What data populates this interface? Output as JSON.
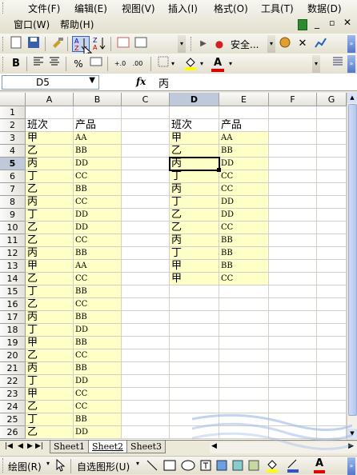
{
  "menu": {
    "items": [
      "文件(F)",
      "编辑(E)",
      "视图(V)",
      "插入(I)",
      "格式(O)",
      "工具(T)",
      "数据(D)"
    ],
    "items_row2": [
      "窗口(W)",
      "帮助(H)"
    ]
  },
  "toolbar": {
    "security_label": "安全...",
    "sort_asc_label": "A↓Z",
    "sort_desc_label": "Z↓A",
    "bold_label": "B",
    "percent_label": "%",
    "font_color_label": "A"
  },
  "formula_bar": {
    "name_box": "D5",
    "fx_label": "fx",
    "value": "丙"
  },
  "grid": {
    "columns": [
      "A",
      "B",
      "C",
      "D",
      "E",
      "F",
      "G"
    ],
    "rows": [
      "1",
      "2",
      "3",
      "4",
      "5",
      "6",
      "7",
      "8",
      "9",
      "10",
      "11",
      "12",
      "13",
      "14",
      "15",
      "16",
      "17",
      "18",
      "19",
      "20",
      "21",
      "22",
      "23",
      "24",
      "25",
      "26"
    ],
    "left_table": {
      "headers": [
        "班次",
        "产品"
      ],
      "data": [
        [
          "甲",
          "AA"
        ],
        [
          "乙",
          "BB"
        ],
        [
          "丙",
          "DD"
        ],
        [
          "丁",
          "CC"
        ],
        [
          "乙",
          "BB"
        ],
        [
          "丙",
          "CC"
        ],
        [
          "丁",
          "DD"
        ],
        [
          "乙",
          "DD"
        ],
        [
          "乙",
          "CC"
        ],
        [
          "丙",
          "BB"
        ],
        [
          "甲",
          "AA"
        ],
        [
          "乙",
          "CC"
        ],
        [
          "丁",
          "BB"
        ],
        [
          "乙",
          "CC"
        ],
        [
          "丙",
          "BB"
        ],
        [
          "丁",
          "DD"
        ],
        [
          "甲",
          "BB"
        ],
        [
          "乙",
          "CC"
        ],
        [
          "丙",
          "BB"
        ],
        [
          "丁",
          "DD"
        ],
        [
          "甲",
          "CC"
        ],
        [
          "乙",
          "CC"
        ],
        [
          "丁",
          "BB"
        ],
        [
          "乙",
          "DD"
        ]
      ]
    },
    "right_table": {
      "headers": [
        "班次",
        "产品"
      ],
      "data": [
        [
          "甲",
          "AA"
        ],
        [
          "乙",
          "BB"
        ],
        [
          "丙",
          "DD"
        ],
        [
          "丁",
          "CC"
        ],
        [
          "丙",
          "CC"
        ],
        [
          "丁",
          "DD"
        ],
        [
          "乙",
          "DD"
        ],
        [
          "乙",
          "CC"
        ],
        [
          "丙",
          "BB"
        ],
        [
          "丁",
          "BB"
        ],
        [
          "甲",
          "BB"
        ],
        [
          "甲",
          "CC"
        ]
      ]
    },
    "active_cell": "D5"
  },
  "sheets": {
    "tabs": [
      "Sheet1",
      "Sheet2",
      "Sheet3"
    ],
    "active": "Sheet2"
  },
  "drawing_toolbar": {
    "draw_label": "绘图(R)",
    "autoshape_label": "自选图形(U)"
  },
  "colors": {
    "cell_fill": "#ffffc8",
    "font_color_accent": "#e00000",
    "fill_color_accent": "#ffff00"
  }
}
